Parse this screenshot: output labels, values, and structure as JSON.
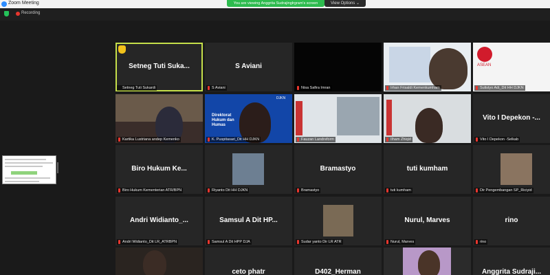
{
  "window": {
    "title": "Zoom Meeting"
  },
  "banner": {
    "sharing_text": "You are viewing Anggrita Sudrajinglrgram's screen",
    "view_options": "View Options ⌄"
  },
  "status": {
    "recording": "Recording"
  },
  "participants": [
    {
      "display": "Setneg Tuti Suka...",
      "label": "Setneg Tuti Sukardi"
    },
    {
      "display": "S Aviani",
      "label": "S Aviani"
    },
    {
      "display": "",
      "label": "Nisa Safira Imran"
    },
    {
      "display": "",
      "label": "Irhan Frisaldi Kemenkumham"
    },
    {
      "display": "",
      "label": "Sulistyo Adi_Dit HH DJKN"
    },
    {
      "display": "",
      "label": "Kartika Lustriana andep Kemenko"
    },
    {
      "display": "",
      "label": "K. Puspitasari_Dit HH DJKN"
    },
    {
      "display": "",
      "label": "Fauzan Landreform"
    },
    {
      "display": "",
      "label": "Ilham Zhiqid"
    },
    {
      "display": "Vito I Depekon -...",
      "label": "Vito I Depekon -Selkab"
    },
    {
      "display": "Biro Hukum Ke...",
      "label": "Biro Hukum Kementerian ATR/BPN"
    },
    {
      "display": "",
      "label": "Riyanto Dit HH DJKN"
    },
    {
      "display": "Bramastyo",
      "label": "Bramastyo"
    },
    {
      "display": "tuti kumham",
      "label": "tuti kumham"
    },
    {
      "display": "",
      "label": "Dir Pengembangan SP_Riciyid"
    },
    {
      "display": "Andri Widianto_...",
      "label": "Andri Widianto_Dit LR_ATRBPN"
    },
    {
      "display": "Samsul A Dit HP...",
      "label": "Samsul A Dit HPP DJA"
    },
    {
      "display": "",
      "label": "Sudar yanto Dir LR ATR"
    },
    {
      "display": "Nurul, Marves",
      "label": "Nurul, Marves"
    },
    {
      "display": "rino",
      "label": "rino"
    },
    {
      "display": "",
      "label": ""
    },
    {
      "display": "ceto phatr",
      "label": ""
    },
    {
      "display": "D402_Herman",
      "label": ""
    },
    {
      "display": "",
      "label": ""
    },
    {
      "display": "Anggrita Sudraji...",
      "label": ""
    }
  ],
  "tile_texts": {
    "directorate_line1": "Direktorat",
    "directorate_line2": "Hukum dan",
    "directorate_line3": "Humas",
    "djkn": "DJKN",
    "asean": "ASEAN"
  },
  "colors": {
    "active_border": "#c6e04a",
    "share_green": "#2dbb4e",
    "record_red": "#e8362e"
  }
}
